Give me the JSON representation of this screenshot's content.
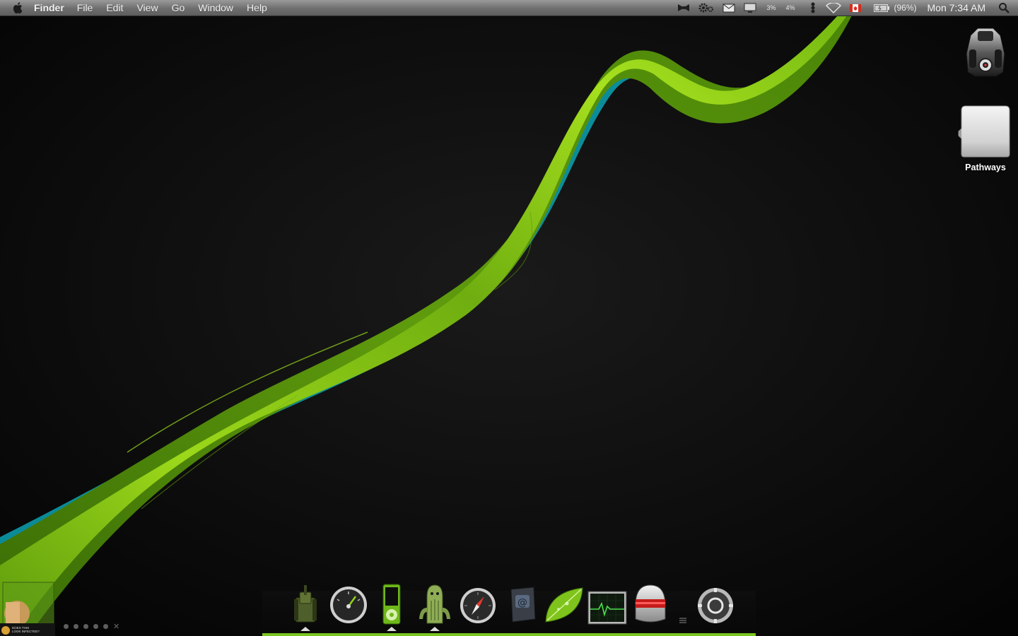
{
  "menubar": {
    "apple_icon": "apple-icon",
    "app_name": "Finder",
    "menus": [
      "File",
      "Edit",
      "View",
      "Go",
      "Window",
      "Help"
    ],
    "cpu_usage_1": "3%",
    "cpu_usage_2": "4%",
    "battery_percent": "(96%)",
    "clock": "Mon 7:34 AM",
    "icons": [
      "bowtie-icon",
      "gear-icon",
      "mail-icon",
      "display-icon",
      "bluetooth-icon",
      "wifi-icon",
      "canada-flag-icon",
      "battery-icon",
      "spotlight-icon"
    ]
  },
  "desktop": {
    "icons": [
      {
        "label": "",
        "icon": "batmobile-icon"
      },
      {
        "label": "Pathways",
        "icon": "external-drive-icon"
      }
    ]
  },
  "dock": {
    "items": [
      {
        "icon": "tank-icon",
        "running": true
      },
      {
        "icon": "dashboard-gauge-icon",
        "running": false
      },
      {
        "icon": "ipod-nano-icon",
        "running": true
      },
      {
        "icon": "cactus-creature-icon",
        "running": true
      },
      {
        "icon": "safari-compass-icon",
        "running": false
      },
      {
        "icon": "mail-stamp-icon",
        "running": false
      },
      {
        "icon": "leaf-icon",
        "running": false
      },
      {
        "icon": "activity-monitor-icon",
        "running": false
      },
      {
        "icon": "robot-helmet-icon",
        "running": false
      },
      {
        "icon": "stacks-separator-icon",
        "running": false
      },
      {
        "icon": "power-button-icon",
        "running": false
      }
    ]
  },
  "widget": {
    "caption_line1": "DOES THIS",
    "caption_line2": "LOOK INFECTED?",
    "pager_dots": 6
  },
  "colors": {
    "ribbon_green": "#8ed317",
    "ribbon_teal": "#0fa8b4",
    "background": "#070707",
    "dock_accent": "#7ac41f"
  }
}
